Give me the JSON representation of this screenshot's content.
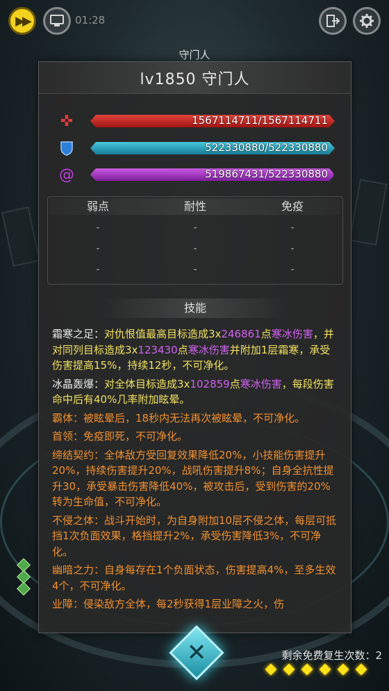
{
  "topbar": {
    "timer": "01:28",
    "speed_icon": "fast-forward-icon",
    "monitor_icon": "monitor-icon",
    "exit_icon": "exit-icon",
    "settings_icon": "gear-icon"
  },
  "boss_tag": "守门人",
  "panel": {
    "title": "lv1850  守门人",
    "stats": {
      "hp": {
        "value": "1567114711/1567114711",
        "fill": 1.0,
        "icon": "cross-hp-icon"
      },
      "shield": {
        "value": "522330880/522330880",
        "fill": 1.0,
        "icon": "shield-icon"
      },
      "energy": {
        "value": "519867431/522330880",
        "fill": 0.995,
        "icon": "spiral-energy-icon"
      }
    },
    "resist": {
      "headers": [
        "弱点",
        "耐性",
        "免疫"
      ],
      "weak": [
        "-",
        "-",
        "-"
      ],
      "resist": [
        "-",
        "-",
        "-"
      ],
      "immune": [
        "-",
        "-",
        "-"
      ]
    },
    "skills_title": "技能",
    "skills": {
      "s1": {
        "name": "霜寒之足：",
        "p1": "对仇恨值最高目标造成3x",
        "n1": "246861",
        "p2": "点",
        "d1": "寒冰伤害",
        "p3": "，并对同列目标造成3x",
        "n2": "123430",
        "p4": "点",
        "d2": "寒冰伤害",
        "p5": "并附加1层霜寒，承受伤害提高15%，持续12秒，不可净化。"
      },
      "s2": {
        "name": "冰晶轰爆：",
        "p1": "对全体目标造成3x",
        "n1": "102859",
        "p2": "点",
        "d1": "寒冰伤害",
        "p3": "，每段伤害命中后有40%几率附加眩晕。"
      },
      "s3": "霸体：被眩晕后，18秒内无法再次被眩晕，不可净化。",
      "s4": "首领：免疫即死，不可净化。",
      "s5": "缔结契约：全体敌方受回复效果降低20%，小技能伤害提升20%，持续伤害提升20%，战吼伤害提升8%；自身全抗性提升30，承受暴击伤害降低40%，被攻击后，受到伤害的20%转为生命值，不可净化。",
      "s6": "不侵之体：战斗开始时，为自身附加10层不侵之体，每层可抵挡1次负面效果，格挡提升2%，承受伤害降低3%，不可净化。",
      "s7": "幽暗之力：自身每存在1个负面状态，伤害提高4%，至多生效4个，不可净化。",
      "s8": "业障：侵染敌方全体，每2秒获得1层业障之火，伤"
    }
  },
  "bottom": {
    "close_icon": "close-x-icon",
    "revive_text": "剩余免费复生次数：2",
    "revive_dots": 6
  },
  "colors": {
    "yellow": "#f0e060",
    "orange": "#f09030",
    "purple": "#d060f0",
    "hp": "#c0201b",
    "shield": "#2aa6c0",
    "energy": "#a83cc8"
  }
}
